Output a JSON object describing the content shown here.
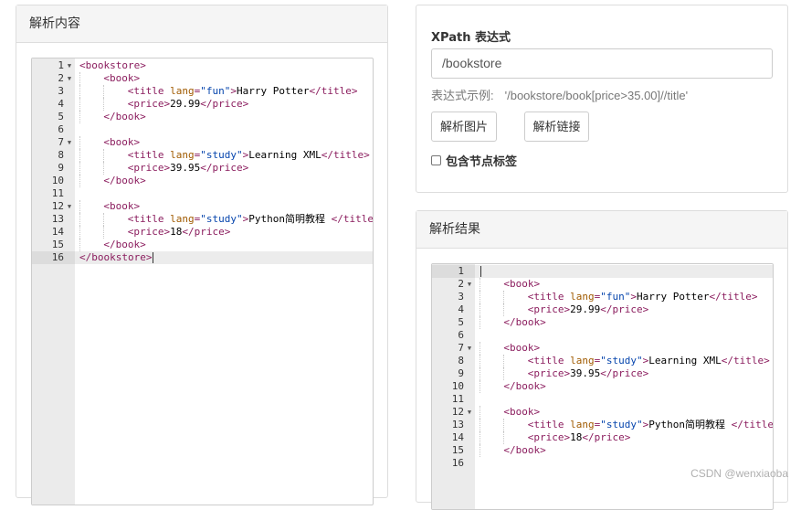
{
  "left_panel": {
    "title": "解析内容",
    "editor": {
      "active_line": 16,
      "lines": [
        {
          "n": "1",
          "fold": true,
          "indent": 0,
          "tokens": [
            [
              "tg",
              "<bookstore>"
            ]
          ]
        },
        {
          "n": "2",
          "fold": true,
          "indent": 1,
          "tokens": [
            [
              "tg",
              "<book>"
            ]
          ]
        },
        {
          "n": "3",
          "fold": false,
          "indent": 2,
          "tokens": [
            [
              "tg",
              "<title "
            ],
            [
              "at",
              "lang"
            ],
            [
              "tg",
              "="
            ],
            [
              "av",
              "\"fun\""
            ],
            [
              "tg",
              ">"
            ],
            [
              "tx",
              "Harry Potter"
            ],
            [
              "tg",
              "</title>"
            ]
          ]
        },
        {
          "n": "4",
          "fold": false,
          "indent": 2,
          "tokens": [
            [
              "tg",
              "<price>"
            ],
            [
              "tx",
              "29.99"
            ],
            [
              "tg",
              "</price>"
            ]
          ]
        },
        {
          "n": "5",
          "fold": false,
          "indent": 1,
          "tokens": [
            [
              "tg",
              "</book>"
            ]
          ]
        },
        {
          "n": "6",
          "fold": false,
          "indent": 0,
          "tokens": []
        },
        {
          "n": "7",
          "fold": true,
          "indent": 1,
          "tokens": [
            [
              "tg",
              "<book>"
            ]
          ]
        },
        {
          "n": "8",
          "fold": false,
          "indent": 2,
          "tokens": [
            [
              "tg",
              "<title "
            ],
            [
              "at",
              "lang"
            ],
            [
              "tg",
              "="
            ],
            [
              "av",
              "\"study\""
            ],
            [
              "tg",
              ">"
            ],
            [
              "tx",
              "Learning XML"
            ],
            [
              "tg",
              "</title>"
            ]
          ]
        },
        {
          "n": "9",
          "fold": false,
          "indent": 2,
          "tokens": [
            [
              "tg",
              "<price>"
            ],
            [
              "tx",
              "39.95"
            ],
            [
              "tg",
              "</price>"
            ]
          ]
        },
        {
          "n": "10",
          "fold": false,
          "indent": 1,
          "tokens": [
            [
              "tg",
              "</book>"
            ]
          ]
        },
        {
          "n": "11",
          "fold": false,
          "indent": 0,
          "tokens": []
        },
        {
          "n": "12",
          "fold": true,
          "indent": 1,
          "tokens": [
            [
              "tg",
              "<book>"
            ]
          ]
        },
        {
          "n": "13",
          "fold": false,
          "indent": 2,
          "tokens": [
            [
              "tg",
              "<title "
            ],
            [
              "at",
              "lang"
            ],
            [
              "tg",
              "="
            ],
            [
              "av",
              "\"study\""
            ],
            [
              "tg",
              ">"
            ],
            [
              "tx",
              "Python简明教程 "
            ],
            [
              "tg",
              "</title>"
            ]
          ]
        },
        {
          "n": "14",
          "fold": false,
          "indent": 2,
          "tokens": [
            [
              "tg",
              "<price>"
            ],
            [
              "tx",
              "18"
            ],
            [
              "tg",
              "</price>"
            ]
          ]
        },
        {
          "n": "15",
          "fold": false,
          "indent": 1,
          "tokens": [
            [
              "tg",
              "</book>"
            ]
          ]
        },
        {
          "n": "16",
          "fold": false,
          "indent": 0,
          "tokens": [
            [
              "tg",
              "</bookstore>"
            ]
          ]
        }
      ]
    }
  },
  "xpath_panel": {
    "label": "XPath 表达式",
    "input_value": "/bookstore",
    "example_label": "表达式示例:",
    "example_value": "'/bookstore/book[price>35.00]//title'",
    "button_parse_image": "解析图片",
    "button_parse_link": "解析链接",
    "checkbox_label": "包含节点标签",
    "checkbox_checked": false
  },
  "result_panel": {
    "title": "解析结果",
    "editor": {
      "active_line": 1,
      "lines": [
        {
          "n": "1",
          "fold": false,
          "indent": 0,
          "tokens": []
        },
        {
          "n": "2",
          "fold": true,
          "indent": 1,
          "tokens": [
            [
              "tg",
              "<book>"
            ]
          ]
        },
        {
          "n": "3",
          "fold": false,
          "indent": 2,
          "tokens": [
            [
              "tg",
              "<title "
            ],
            [
              "at",
              "lang"
            ],
            [
              "tg",
              "="
            ],
            [
              "av",
              "\"fun\""
            ],
            [
              "tg",
              ">"
            ],
            [
              "tx",
              "Harry Potter"
            ],
            [
              "tg",
              "</title>"
            ]
          ]
        },
        {
          "n": "4",
          "fold": false,
          "indent": 2,
          "tokens": [
            [
              "tg",
              "<price>"
            ],
            [
              "tx",
              "29.99"
            ],
            [
              "tg",
              "</price>"
            ]
          ]
        },
        {
          "n": "5",
          "fold": false,
          "indent": 1,
          "tokens": [
            [
              "tg",
              "</book>"
            ]
          ]
        },
        {
          "n": "6",
          "fold": false,
          "indent": 0,
          "tokens": []
        },
        {
          "n": "7",
          "fold": true,
          "indent": 1,
          "tokens": [
            [
              "tg",
              "<book>"
            ]
          ]
        },
        {
          "n": "8",
          "fold": false,
          "indent": 2,
          "tokens": [
            [
              "tg",
              "<title "
            ],
            [
              "at",
              "lang"
            ],
            [
              "tg",
              "="
            ],
            [
              "av",
              "\"study\""
            ],
            [
              "tg",
              ">"
            ],
            [
              "tx",
              "Learning XML"
            ],
            [
              "tg",
              "</title>"
            ]
          ]
        },
        {
          "n": "9",
          "fold": false,
          "indent": 2,
          "tokens": [
            [
              "tg",
              "<price>"
            ],
            [
              "tx",
              "39.95"
            ],
            [
              "tg",
              "</price>"
            ]
          ]
        },
        {
          "n": "10",
          "fold": false,
          "indent": 1,
          "tokens": [
            [
              "tg",
              "</book>"
            ]
          ]
        },
        {
          "n": "11",
          "fold": false,
          "indent": 0,
          "tokens": []
        },
        {
          "n": "12",
          "fold": true,
          "indent": 1,
          "tokens": [
            [
              "tg",
              "<book>"
            ]
          ]
        },
        {
          "n": "13",
          "fold": false,
          "indent": 2,
          "tokens": [
            [
              "tg",
              "<title "
            ],
            [
              "at",
              "lang"
            ],
            [
              "tg",
              "="
            ],
            [
              "av",
              "\"study\""
            ],
            [
              "tg",
              ">"
            ],
            [
              "tx",
              "Python简明教程 "
            ],
            [
              "tg",
              "</title>"
            ]
          ]
        },
        {
          "n": "14",
          "fold": false,
          "indent": 2,
          "tokens": [
            [
              "tg",
              "<price>"
            ],
            [
              "tx",
              "18"
            ],
            [
              "tg",
              "</price>"
            ]
          ]
        },
        {
          "n": "15",
          "fold": false,
          "indent": 1,
          "tokens": [
            [
              "tg",
              "</book>"
            ]
          ]
        },
        {
          "n": "16",
          "fold": false,
          "indent": 0,
          "tokens": []
        }
      ]
    }
  },
  "watermark": "CSDN @wenxiaoba",
  "colors": {
    "tag": "#8b1d5e",
    "attribute": "#a05a00",
    "attribute_value": "#0645ad",
    "panel_heading_bg": "#f5f5f5",
    "gutter_bg": "#ebebeb"
  }
}
